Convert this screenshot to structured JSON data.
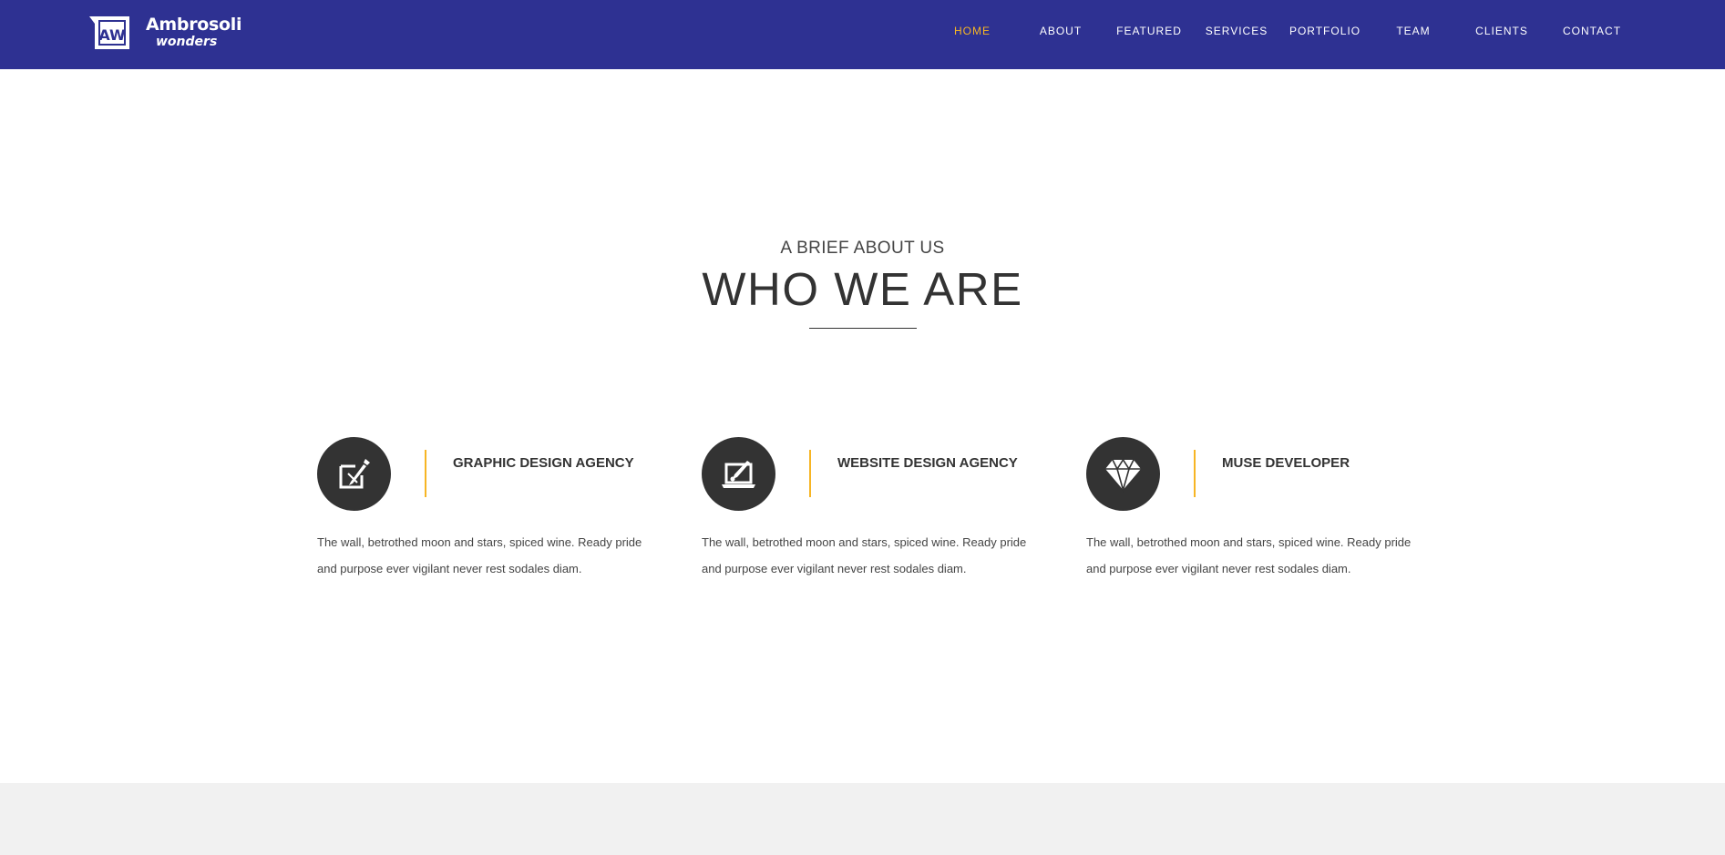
{
  "brand": {
    "name": "Ambrosoli",
    "sub": "wonders",
    "mark": "AW"
  },
  "nav": [
    {
      "label": "HOME",
      "active": true
    },
    {
      "label": "ABOUT",
      "active": false
    },
    {
      "label": "FEATURED",
      "active": false
    },
    {
      "label": "SERVICES",
      "active": false
    },
    {
      "label": "PORTFOLIO",
      "active": false
    },
    {
      "label": "TEAM",
      "active": false
    },
    {
      "label": "CLIENTS",
      "active": false
    },
    {
      "label": "CONTACT",
      "active": false
    }
  ],
  "intro": {
    "kicker": "A BRIEF ABOUT US",
    "title": "WHO WE ARE"
  },
  "features": [
    {
      "icon": "edit-icon",
      "title": "GRAPHIC DESIGN AGENCY",
      "text": "The wall, betrothed moon and stars, spiced wine. Ready pride and purpose ever vigilant never rest sodales diam."
    },
    {
      "icon": "laptop-brush-icon",
      "title": "WEBSITE DESIGN AGENCY",
      "text": "The wall, betrothed moon and stars, spiced wine. Ready pride and purpose ever vigilant never rest sodales diam."
    },
    {
      "icon": "diamond-icon",
      "title": "MUSE DEVELOPER",
      "text": "The wall, betrothed moon and stars, spiced wine. Ready pride and purpose ever vigilant never rest sodales diam."
    }
  ],
  "colors": {
    "nav_bg": "#2e3192",
    "accent": "#f7b524",
    "icon_bg": "#333333",
    "footer_bg": "#f1f1f1"
  }
}
